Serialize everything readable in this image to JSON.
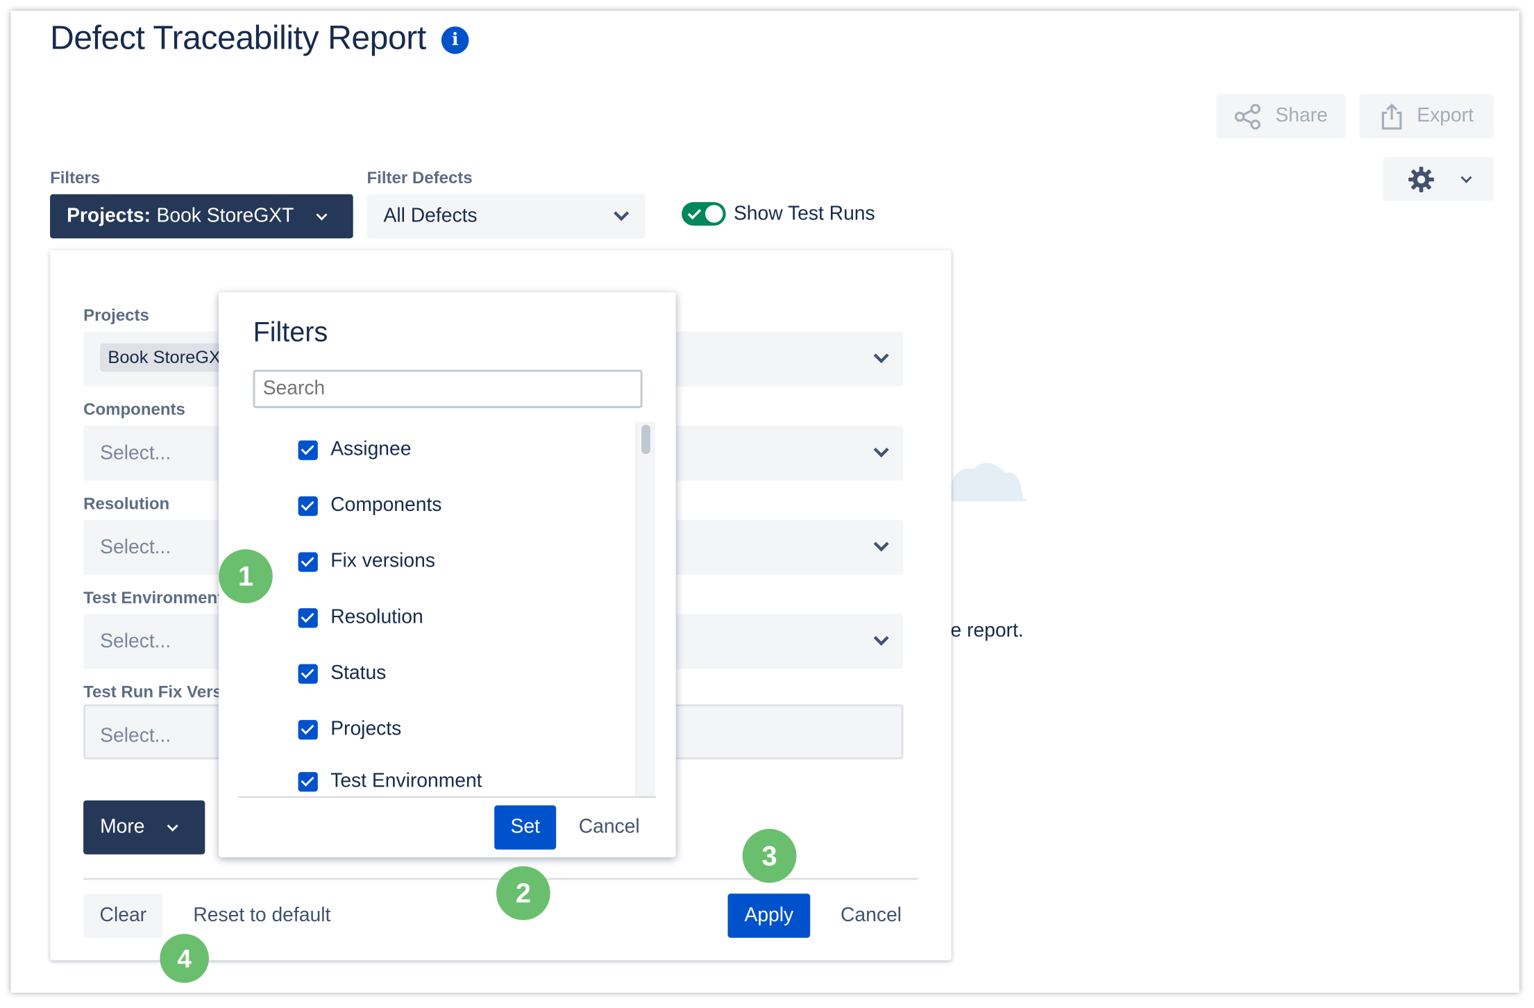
{
  "page": {
    "title": "Defect Traceability Report"
  },
  "toolbar": {
    "share_label": "Share",
    "export_label": "Export"
  },
  "filters_bar": {
    "filters_label": "Filters",
    "projects_button": {
      "prefix": "Projects:",
      "value": "Book StoreGXT"
    },
    "filter_defects_label": "Filter Defects",
    "filter_defects_value": "All Defects",
    "show_test_runs_label": "Show Test Runs",
    "show_test_runs_on": true
  },
  "panel": {
    "projects": {
      "label": "Projects",
      "chip": "Book StoreGXT"
    },
    "components": {
      "label": "Components",
      "placeholder": "Select..."
    },
    "resolution": {
      "label": "Resolution",
      "placeholder": "Select..."
    },
    "test_environment": {
      "label": "Test Environment",
      "placeholder": "Select..."
    },
    "test_run_fix_version": {
      "label": "Test Run Fix Version",
      "placeholder": "Select..."
    },
    "more_label": "More",
    "clear_label": "Clear",
    "reset_label": "Reset to default",
    "apply_label": "Apply",
    "cancel_label": "Cancel"
  },
  "background_text": "he report.",
  "popup": {
    "title": "Filters",
    "search_placeholder": "Search",
    "options": [
      {
        "label": "Assignee",
        "checked": true
      },
      {
        "label": "Components",
        "checked": true
      },
      {
        "label": "Fix versions",
        "checked": true
      },
      {
        "label": "Resolution",
        "checked": true
      },
      {
        "label": "Status",
        "checked": true
      },
      {
        "label": "Projects",
        "checked": true
      },
      {
        "label": "Test Environment",
        "checked": true
      }
    ],
    "set_label": "Set",
    "cancel_label": "Cancel"
  },
  "callouts": [
    "1",
    "2",
    "3",
    "4"
  ],
  "colors": {
    "primary": "#0052cc",
    "dark": "#253858",
    "badge": "#6abf6f",
    "toggle": "#00875a"
  }
}
